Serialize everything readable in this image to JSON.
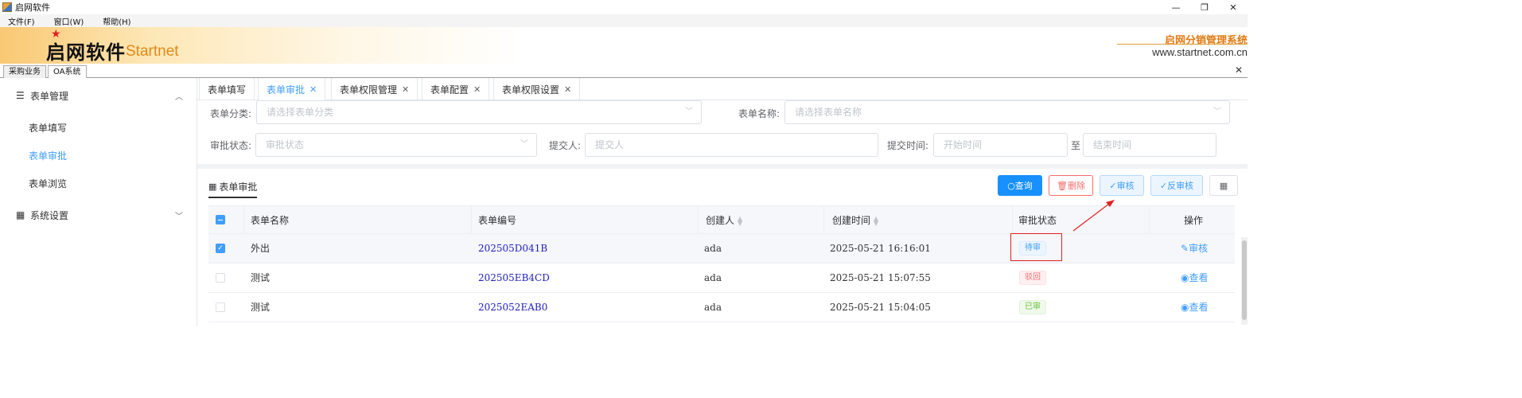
{
  "window": {
    "title": "启网软件",
    "minimize": "—",
    "restore": "❐",
    "close": "✕"
  },
  "menu": [
    {
      "label": "文件(F)"
    },
    {
      "label": "窗口(W)"
    },
    {
      "label": "帮助(H)"
    }
  ],
  "banner": {
    "logo_cn": "启网软件",
    "logo_en": "Startnet",
    "brand": "启网分销管理系统",
    "url": "www.startnet.com.cn"
  },
  "top_tabs": [
    {
      "label": "采购业务"
    },
    {
      "label": "OA系统"
    }
  ],
  "top_close": "✕",
  "sidebar": {
    "group1": {
      "label": "表单管理",
      "icon": "sliders-icon",
      "expanded": true
    },
    "items": [
      {
        "label": "表单填写"
      },
      {
        "label": "表单审批"
      },
      {
        "label": "表单浏览"
      }
    ],
    "group2": {
      "label": "系统设置",
      "icon": "grid-icon",
      "expanded": false
    }
  },
  "page_tabs": [
    {
      "label": "表单填写",
      "closable": false
    },
    {
      "label": "表单审批",
      "closable": true
    },
    {
      "label": "表单权限管理",
      "closable": true
    },
    {
      "label": "表单配置",
      "closable": true
    },
    {
      "label": "表单权限设置",
      "closable": true
    }
  ],
  "filters": {
    "category_label": "表单分类:",
    "category_placeholder": "请选择表单分类",
    "name_label": "表单名称:",
    "name_placeholder": "请选择表单名称",
    "status_label": "审批状态:",
    "status_placeholder": "审批状态",
    "submitter_label": "提交人:",
    "submitter_placeholder": "提交人",
    "time_label": "提交时间:",
    "start_placeholder": "开始时间",
    "to": "至",
    "end_placeholder": "结束时间"
  },
  "panel": {
    "title": "表单审批"
  },
  "buttons": {
    "query": "查询",
    "delete": "删除",
    "audit": "审核",
    "unaudit": "反审核"
  },
  "columns": [
    "表单名称",
    "表单编号",
    "创建人",
    "创建时间",
    "审批状态",
    "操作"
  ],
  "rows": [
    {
      "name": "外出",
      "code": "202505D041B",
      "creator": "ada",
      "time": "2025-05-21 16:16:01",
      "status": "待审",
      "status_type": "wait",
      "action": "审核",
      "checked": true
    },
    {
      "name": "测试",
      "code": "202505EB4CD",
      "creator": "ada",
      "time": "2025-05-21 15:07:55",
      "status": "驳回",
      "status_type": "rejected",
      "action": "查看",
      "checked": false
    },
    {
      "name": "测试",
      "code": "2025052EAB0",
      "creator": "ada",
      "time": "2025-05-21 15:04:05",
      "status": "已审",
      "status_type": "approved",
      "action": "查看",
      "checked": false
    }
  ],
  "colors": {
    "accent": "#409eff",
    "query_btn": "#1890ff",
    "danger": "#f56c6c",
    "success": "#67c23a",
    "annotation": "#e02020",
    "brand_orange": "#e07a12"
  }
}
